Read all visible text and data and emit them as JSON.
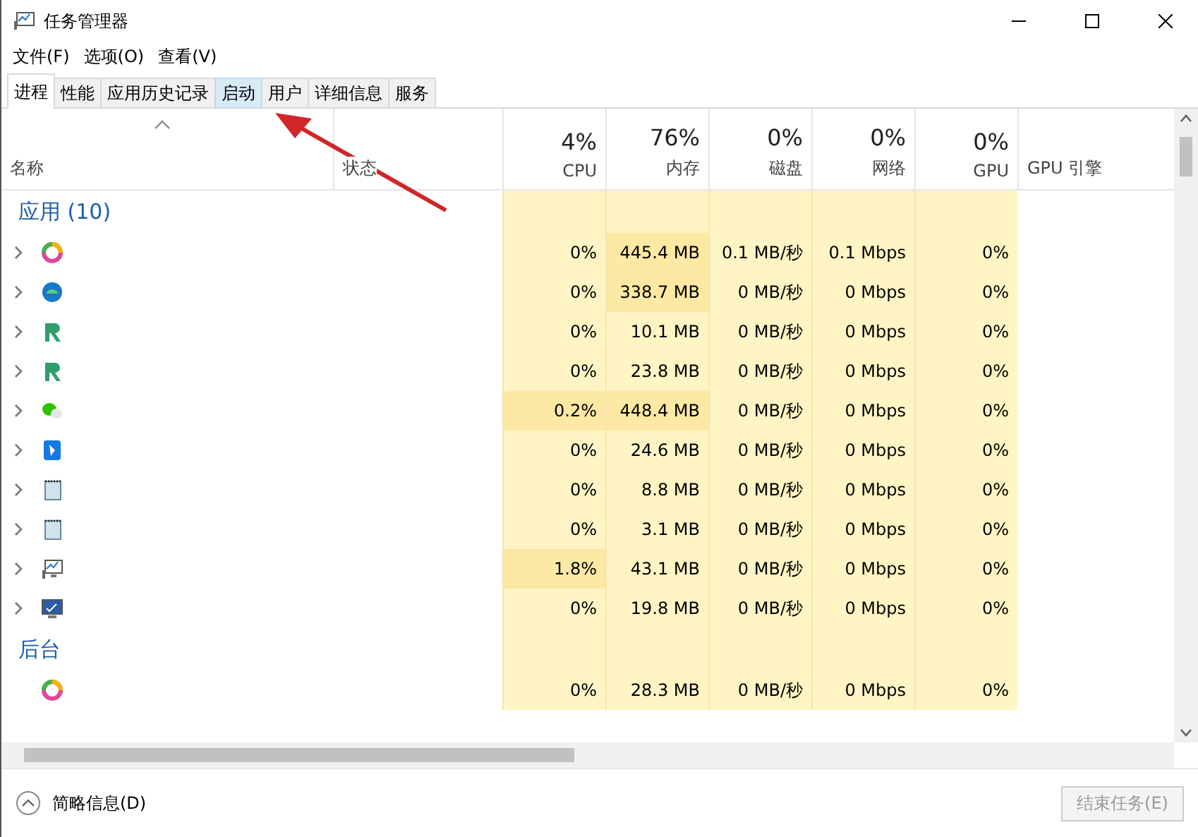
{
  "window": {
    "title": "任务管理器"
  },
  "menu": [
    "文件(F)",
    "选项(O)",
    "查看(V)"
  ],
  "tabs": [
    {
      "label": "进程",
      "selected": true,
      "hovered": false
    },
    {
      "label": "性能",
      "selected": false,
      "hovered": false
    },
    {
      "label": "应用历史记录",
      "selected": false,
      "hovered": false
    },
    {
      "label": "启动",
      "selected": false,
      "hovered": true
    },
    {
      "label": "用户",
      "selected": false,
      "hovered": false
    },
    {
      "label": "详细信息",
      "selected": false,
      "hovered": false
    },
    {
      "label": "服务",
      "selected": false,
      "hovered": false
    }
  ],
  "name_column": {
    "label": "名称"
  },
  "status_column": {
    "label": "状态"
  },
  "metric_columns": [
    {
      "percent": "4%",
      "label": "CPU"
    },
    {
      "percent": "76%",
      "label": "内存"
    },
    {
      "percent": "0%",
      "label": "磁盘"
    },
    {
      "percent": "0%",
      "label": "网络"
    },
    {
      "percent": "0%",
      "label": "GPU"
    }
  ],
  "engine_column": {
    "label": "GPU 引擎"
  },
  "groups": [
    {
      "title": "应用 (10)",
      "rows": [
        {
          "expandable": true,
          "cells": [
            {
              "text": "0%",
              "hot": false
            },
            {
              "text": "445.4 MB",
              "hot": true
            },
            {
              "text": "0.1 MB/秒",
              "hot": false
            },
            {
              "text": "0.1 Mbps",
              "hot": false
            },
            {
              "text": "0%",
              "hot": false
            }
          ]
        },
        {
          "expandable": true,
          "cells": [
            {
              "text": "0%",
              "hot": false
            },
            {
              "text": "338.7 MB",
              "hot": true
            },
            {
              "text": "0 MB/秒",
              "hot": false
            },
            {
              "text": "0 Mbps",
              "hot": false
            },
            {
              "text": "0%",
              "hot": false
            }
          ]
        },
        {
          "expandable": true,
          "cells": [
            {
              "text": "0%",
              "hot": false
            },
            {
              "text": "10.1 MB",
              "hot": false
            },
            {
              "text": "0 MB/秒",
              "hot": false
            },
            {
              "text": "0 Mbps",
              "hot": false
            },
            {
              "text": "0%",
              "hot": false
            }
          ]
        },
        {
          "expandable": true,
          "cells": [
            {
              "text": "0%",
              "hot": false
            },
            {
              "text": "23.8 MB",
              "hot": false
            },
            {
              "text": "0 MB/秒",
              "hot": false
            },
            {
              "text": "0 Mbps",
              "hot": false
            },
            {
              "text": "0%",
              "hot": false
            }
          ]
        },
        {
          "expandable": true,
          "cells": [
            {
              "text": "0.2%",
              "hot": true
            },
            {
              "text": "448.4 MB",
              "hot": true
            },
            {
              "text": "0 MB/秒",
              "hot": false
            },
            {
              "text": "0 Mbps",
              "hot": false
            },
            {
              "text": "0%",
              "hot": false
            }
          ]
        },
        {
          "expandable": true,
          "cells": [
            {
              "text": "0%",
              "hot": false
            },
            {
              "text": "24.6 MB",
              "hot": false
            },
            {
              "text": "0 MB/秒",
              "hot": false
            },
            {
              "text": "0 Mbps",
              "hot": false
            },
            {
              "text": "0%",
              "hot": false
            }
          ]
        },
        {
          "expandable": true,
          "cells": [
            {
              "text": "0%",
              "hot": false
            },
            {
              "text": "8.8 MB",
              "hot": false
            },
            {
              "text": "0 MB/秒",
              "hot": false
            },
            {
              "text": "0 Mbps",
              "hot": false
            },
            {
              "text": "0%",
              "hot": false
            }
          ]
        },
        {
          "expandable": true,
          "cells": [
            {
              "text": "0%",
              "hot": false
            },
            {
              "text": "3.1 MB",
              "hot": false
            },
            {
              "text": "0 MB/秒",
              "hot": false
            },
            {
              "text": "0 Mbps",
              "hot": false
            },
            {
              "text": "0%",
              "hot": false
            }
          ]
        },
        {
          "expandable": true,
          "cells": [
            {
              "text": "1.8%",
              "hot": true
            },
            {
              "text": "43.1 MB",
              "hot": false
            },
            {
              "text": "0 MB/秒",
              "hot": false
            },
            {
              "text": "0 Mbps",
              "hot": false
            },
            {
              "text": "0%",
              "hot": false
            }
          ]
        },
        {
          "expandable": true,
          "cells": [
            {
              "text": "0%",
              "hot": false
            },
            {
              "text": "19.8 MB",
              "hot": false
            },
            {
              "text": "0 MB/秒",
              "hot": false
            },
            {
              "text": "0 Mbps",
              "hot": false
            },
            {
              "text": "0%",
              "hot": false
            }
          ]
        }
      ]
    },
    {
      "title": "后台",
      "rows": [
        {
          "expandable": false,
          "cells": [
            {
              "text": "0%",
              "hot": false
            },
            {
              "text": "28.3 MB",
              "hot": false
            },
            {
              "text": "0 MB/秒",
              "hot": false
            },
            {
              "text": "0 Mbps",
              "hot": false
            },
            {
              "text": "0%",
              "hot": false
            }
          ]
        }
      ]
    }
  ],
  "footer": {
    "details": "简略信息(D)",
    "end_task": {
      "label": "结束任务(E)",
      "disabled": true
    }
  }
}
